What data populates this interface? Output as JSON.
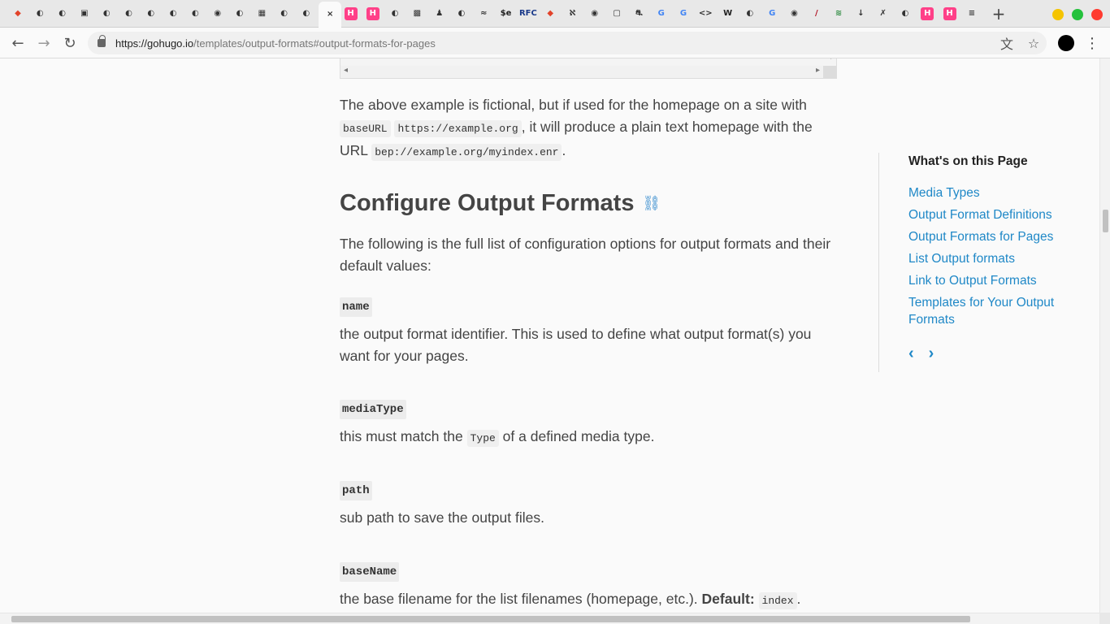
{
  "browser": {
    "url_host": "https://gohugo.io",
    "url_path": "/templates/output-formats#output-formats-for-pages",
    "active_tab_close": "×",
    "new_tab": "+",
    "tab_icons": [
      "gitlab-icon",
      "github-icon",
      "github-icon",
      "folder-icon",
      "github-icon",
      "github-icon",
      "github-icon",
      "github-icon",
      "github-icon",
      "globe-icon",
      "github-icon",
      "image-icon",
      "github-icon",
      "github-icon",
      "close-icon",
      "hugo-icon",
      "hugo-icon",
      "github-icon",
      "avatar-icon",
      "figure-icon",
      "github-icon",
      "bird-icon",
      "dollar-icon",
      "rfc-icon",
      "gitlab-icon",
      "a-icon",
      "globe-icon",
      "box-icon",
      "car-icon",
      "google-icon",
      "google-icon",
      "code-icon",
      "wikipedia-icon",
      "github-icon",
      "google-icon",
      "globe-icon",
      "slash-icon",
      "layers-icon",
      "pin-icon",
      "x-icon",
      "github-icon",
      "hugo-icon",
      "hugo-icon",
      "stack-icon"
    ],
    "tab_labels": [
      "◆",
      "◐",
      "◐",
      "▣",
      "◐",
      "◐",
      "◐",
      "◐",
      "◐",
      "◉",
      "◐",
      "▦",
      "◐",
      "◐",
      "×",
      "H",
      "H",
      "◐",
      "▩",
      "♟",
      "◐",
      "≈",
      "$e",
      "RFC",
      "◆",
      "ℵ",
      "◉",
      "▢",
      "⛐",
      "G",
      "G",
      "<>",
      "W",
      "◐",
      "G",
      "◉",
      "/",
      "≋",
      "↓",
      "✗",
      "◐",
      "H",
      "H",
      "≡"
    ]
  },
  "code_snippet": {
    "left_arrow": "◂",
    "right_arrow": "▸",
    "down_arrow": "▾"
  },
  "intro": {
    "text_1": "The above example is fictional, but if used for the homepage on a site with ",
    "code_1": "baseURL",
    "code_2": "https://example.org",
    "text_2": ", it will produce a plain text homepage with the URL ",
    "code_3": "bep://example.org/myindex.enr",
    "text_3": "."
  },
  "section": {
    "title": "Configure Output Formats",
    "link_icon": "⛓",
    "intro": "The following is the full list of configuration options for output formats and their default values:"
  },
  "options": [
    {
      "name": "name",
      "desc": "the output format identifier. This is used to define what output format(s) you want for your pages."
    },
    {
      "name": "mediaType",
      "desc_pre": "this must match the ",
      "desc_code": "Type",
      "desc_post": " of a defined media type."
    },
    {
      "name": "path",
      "desc": "sub path to save the output files."
    },
    {
      "name": "baseName",
      "desc_pre": "the base filename for the list filenames (homepage, etc.). ",
      "desc_bold": "Default:",
      "desc_code": "index",
      "desc_post": "."
    }
  ],
  "toc": {
    "title": "What's on this Page",
    "items": [
      "Media Types",
      "Output Format Definitions",
      "Output Formats for Pages",
      "List Output formats",
      "Link to Output Formats",
      "Templates for Your Output Formats"
    ],
    "prev": "‹",
    "next": "›"
  },
  "colors": {
    "link": "#1f88c7",
    "text": "#444444",
    "win_min": "#f5c400",
    "win_max": "#24c13c",
    "win_close": "#ff3b30"
  }
}
